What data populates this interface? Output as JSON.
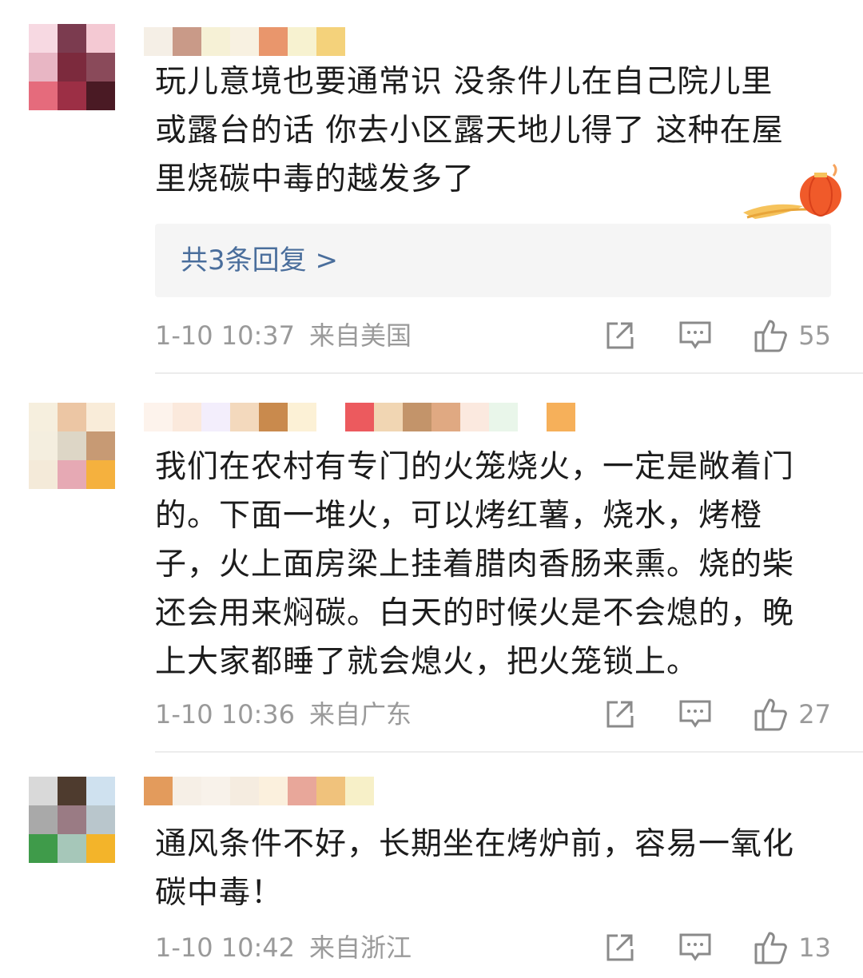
{
  "comments": [
    {
      "text": "玩儿意境也要通常识 没条件儿在自己院儿里\n或露台的话 你去小区露天地儿得了 这种在屋\n里烧碳中毒的越发多了",
      "reply_link": "共3条回复 >",
      "time": "1-10 10:37",
      "location": "来自美国",
      "likes": "55",
      "avatar_colors": [
        "#f7d9e2",
        "#7b3b4f",
        "#f4c9d3",
        "#e8b6c4",
        "#7c2a3d",
        "#8a4a5a",
        "#e56b7c",
        "#9c2f45",
        "#4a1a24"
      ],
      "name_colors": [
        "#f5efe6",
        "#c99a88",
        "#f6f1d6",
        "#f8f1e1",
        "#e9966c",
        "#f7f2d0",
        "#f4d27b",
        "#ffffff"
      ]
    },
    {
      "text": "我们在农村有专门的火笼烧火，一定是敞着门\n的。下面一堆火，可以烤红薯，烧水，烤橙\n子，火上面房梁上挂着腊肉香肠来熏。烧的柴\n还会用来焖碳。白天的时候火是不会熄的，晚\n上大家都睡了就会熄火，把火笼锁上。",
      "time": "1-10 10:36",
      "location": "来自广东",
      "likes": "27",
      "avatar_colors": [
        "#f6efde",
        "#ecc6a4",
        "#f9ecd9",
        "#f4eedf",
        "#ddd6c6",
        "#c79a74",
        "#f4ead9",
        "#e6a9b4",
        "#f5b13e"
      ],
      "name_colors": [
        "#fdf3ec",
        "#fbe9dc",
        "#f3eefc",
        "#f3d9bd",
        "#c98a4d",
        "#fcf1d6",
        "#ffffff",
        "#ec5a5e",
        "#f1d6b3",
        "#c3946a",
        "#e0a982",
        "#fbe9df",
        "#e9f6ea",
        "#ffffff",
        "#f6b05a"
      ]
    },
    {
      "text": "通风条件不好，长期坐在烤炉前，容易一氧化\n碳中毒！",
      "time": "1-10 10:42",
      "location": "来自浙江",
      "likes": "13",
      "avatar_colors": [
        "#d9d9d9",
        "#4e3b2e",
        "#cfe1ef",
        "#a9a9a9",
        "#9a7b84",
        "#b9c6cc",
        "#3f9b4a",
        "#a6c7b9",
        "#f3b42a"
      ],
      "name_colors": [
        "#e39b5c",
        "#f6efe6",
        "#f8f2ea",
        "#f5ece0",
        "#fbf0dd",
        "#e8a79a",
        "#f0c27c",
        "#f7f0c8"
      ]
    }
  ],
  "accent": "#4a6e9c",
  "meta_color": "#9a9a9a"
}
